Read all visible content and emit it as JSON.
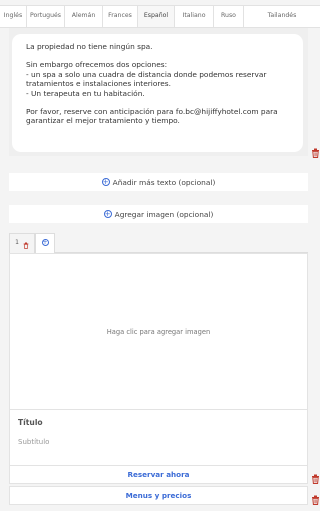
{
  "tabs": [
    {
      "label": "Inglés"
    },
    {
      "label": "Portugués"
    },
    {
      "label": "Alemán"
    },
    {
      "label": "Frances"
    },
    {
      "label": "Español",
      "active": true
    },
    {
      "label": "Italiano"
    },
    {
      "label": "Ruso"
    },
    {
      "label": "Tailandés"
    }
  ],
  "message": {
    "line1": "La propiedad no tiene ningún spa.",
    "line2": "Sin embargo ofrecemos dos opciones:",
    "line3": "- un spa a solo una cuadra de distancia donde podemos reservar tratamientos e instalaciones interiores.",
    "line4": "- Un terapeuta en tu habitación.",
    "line5": "Por favor, reserve con anticipación para fo.bc@hijiffyhotel.com para garantizar el mejor tratamiento y tiempo."
  },
  "buttons": {
    "add_text": "Añadir más texto (opcional)",
    "add_image": "Agregar imagen (opcional)"
  },
  "image_tabs": {
    "first_label": "1",
    "add_label": "+"
  },
  "image_panel": {
    "placeholder": "Haga clic para agregar imagen"
  },
  "card": {
    "title": "Título",
    "subtitle": "Subtítulo"
  },
  "actions": {
    "reserve": "Reservar ahora",
    "menus": "Menus y precios"
  },
  "colors": {
    "accent": "#3b6bd6",
    "delete": "#c0392b"
  },
  "icons": {
    "delete": "trash-icon",
    "add": "plus-circle-icon"
  }
}
